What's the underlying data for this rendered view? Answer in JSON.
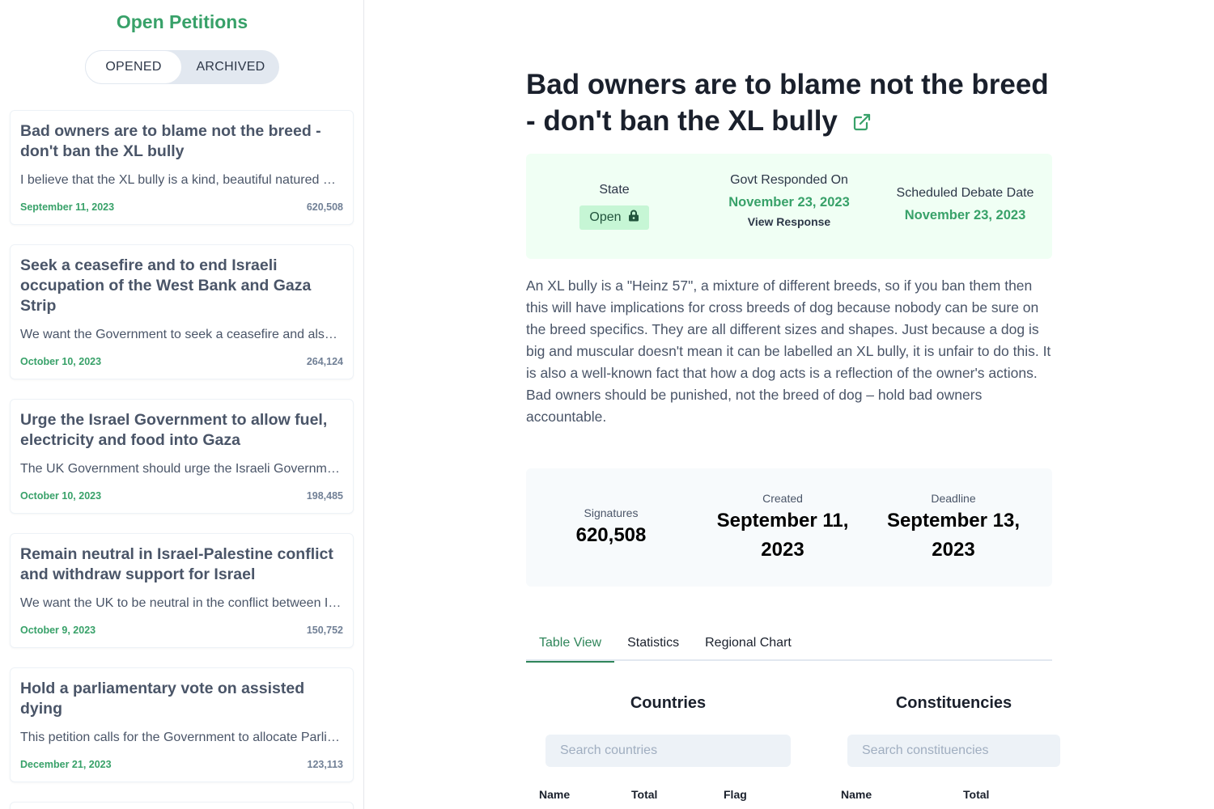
{
  "sidebar": {
    "title": "Open Petitions",
    "toggle": {
      "opened": "OPENED",
      "archived": "ARCHIVED",
      "active": "opened"
    },
    "petitions": [
      {
        "title": "Bad owners are to blame not the breed - don't ban the XL bully",
        "desc": "I believe that the XL bully is a kind, beautiful natured dog and is being held responsible for bad owners.",
        "date": "September 11, 2023",
        "count": "620,508"
      },
      {
        "title": "Seek a ceasefire and to end Israeli occupation of the West Bank and Gaza Strip",
        "desc": "We want the Government to seek a ceasefire and also to end the occupation.",
        "date": "October 10, 2023",
        "count": "264,124"
      },
      {
        "title": "Urge the Israel Government to allow fuel, electricity and food into Gaza",
        "desc": "The UK Government should urge the Israeli Government to allow fuel, electricity and food.",
        "date": "October 10, 2023",
        "count": "198,485"
      },
      {
        "title": "Remain neutral in Israel-Palestine conflict and withdraw support for Israel",
        "desc": "We want the UK to be neutral in the conflict between Israel and Palestine.",
        "date": "October 9, 2023",
        "count": "150,752"
      },
      {
        "title": "Hold a parliamentary vote on assisted dying",
        "desc": "This petition calls for the Government to allocate Parliamentary time for a debate.",
        "date": "December 21, 2023",
        "count": "123,113"
      }
    ]
  },
  "main": {
    "title": "Bad owners are to blame not the breed - don't ban the XL bully",
    "status": {
      "state_label": "State",
      "state_value": "Open",
      "govt_label": "Govt Responded On",
      "govt_value": "November 23, 2023",
      "view_response": "View Response",
      "debate_label": "Scheduled Debate Date",
      "debate_value": "November 23, 2023"
    },
    "description": "An XL bully is a \"Heinz 57\", a mixture of different breeds, so if you ban them then this will have implications for cross breeds of dog because nobody can be sure on the breed specifics. They are all different sizes and shapes. Just because a dog is big and muscular doesn't mean it can be labelled an XL bully, it is unfair to do this. It is also a well-known fact that how a dog acts is a reflection of the owner's actions. Bad owners should be punished, not the breed of dog – hold bad owners accountable.",
    "stats": {
      "signatures_label": "Signatures",
      "signatures_value": "620,508",
      "created_label": "Created",
      "created_value": "September 11, 2023",
      "deadline_label": "Deadline",
      "deadline_value": "September 13, 2023"
    },
    "tabs": [
      "Table View",
      "Statistics",
      "Regional Chart"
    ],
    "active_tab": "Table View",
    "countries": {
      "title": "Countries",
      "search_placeholder": "Search countries",
      "columns": [
        "Name",
        "Total",
        "Flag"
      ]
    },
    "constituencies": {
      "title": "Constituencies",
      "search_placeholder": "Search constituencies",
      "columns": [
        "Name",
        "Total"
      ]
    }
  },
  "colors": {
    "accent": "#38a169",
    "status_bg": "#f0fff4",
    "stats_bg": "#f7fafc"
  }
}
